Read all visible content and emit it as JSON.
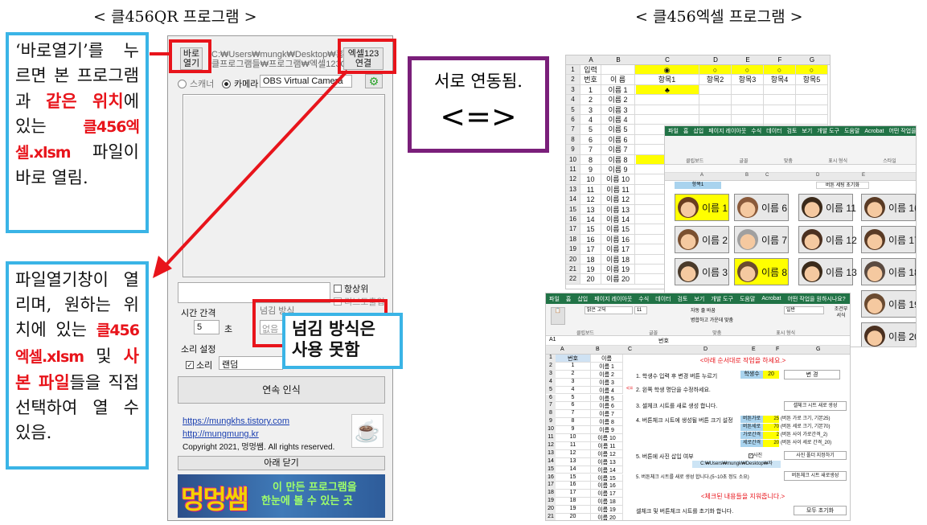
{
  "titles": {
    "left": "< 클456QR 프로그램 >",
    "right": "< 클456엑셀 프로그램 >"
  },
  "program": {
    "open_btn": "바로\n열기",
    "path_line1": "C:₩Users₩mungk₩Desktop₩홍",
    "path_line2": "클프로그램들₩프로그램₩엑셀123QR",
    "excel_btn": "엑셀123\n연결",
    "scanner": "스캐너",
    "camera": "카메라",
    "camera_select": "OBS Virtual Camera",
    "top_check": "항상위",
    "auto_check": "리브도출입",
    "interval_label": "시간 간격",
    "interval_value": "5",
    "interval_unit": "초",
    "mode_label": "넘김 방식",
    "mode_value": "없음",
    "sound_label": "소리 설정",
    "sound_check": "소리",
    "sound_value": "랜덤",
    "continuous": "연속 인식",
    "link1": "https://mungkhs.tistory.com",
    "link2": "http://mungmung.kr",
    "copyright": "Copyright 2021, 멍멍쌤. All rights reserved.",
    "close": "아래 닫기",
    "banner_logo": "멍멍쌤",
    "banner_line1": "이 만든 프로그램을",
    "banner_line2": "한눈에 볼 수 있는 곳"
  },
  "notes": {
    "open": {
      "a": "‘바로열기’를 누르면 본 프로그램과 ",
      "b": "같은 위치",
      "c": "에 있는 ",
      "d": "클456엑셀.xlsm",
      "e": " 파일이 바로 열림."
    },
    "excel": {
      "a": "파일열기창이 열리며, 원하는 위치에 있는 ",
      "b": "클456엑셀.xlsm",
      "c": " 및 ",
      "d": "사본 파일",
      "e": "들을 직접 선택하여 열 수 있음."
    },
    "mode": "넘김 방식은 사용 못함",
    "linked_line1": "서로 연동됨.",
    "linked_line2": "<=>"
  },
  "excel1": {
    "cols": [
      "A",
      "B",
      "C",
      "D",
      "E",
      "F",
      "G"
    ],
    "row1_label": "입력",
    "header": [
      "번호",
      "이 름",
      "항목1",
      "항목2",
      "항목3",
      "항목4",
      "항목5"
    ],
    "rows": [
      [
        "1",
        "이름 1"
      ],
      [
        "2",
        "이름 2"
      ],
      [
        "3",
        "이름 3"
      ],
      [
        "4",
        "이름 4"
      ],
      [
        "5",
        "이름 5"
      ],
      [
        "6",
        "이름 6"
      ],
      [
        "7",
        "이름 7"
      ],
      [
        "8",
        "이름 8"
      ],
      [
        "9",
        "이름 9"
      ],
      [
        "10",
        "이름 10"
      ],
      [
        "11",
        "이름 11"
      ],
      [
        "12",
        "이름 12"
      ],
      [
        "13",
        "이름 13"
      ],
      [
        "14",
        "이름 14"
      ],
      [
        "15",
        "이름 15"
      ],
      [
        "16",
        "이름 16"
      ],
      [
        "17",
        "이름 17"
      ],
      [
        "18",
        "이름 18"
      ],
      [
        "19",
        "이름 19"
      ],
      [
        "20",
        "이름 20"
      ]
    ],
    "mark": "♣"
  },
  "excel2": {
    "tabs": [
      "파일",
      "홈",
      "삽입",
      "페이지 레이아웃",
      "수식",
      "데이터",
      "검토",
      "보기",
      "개발 도구",
      "도움말",
      "Acrobat",
      "어떤 작업을 원하시나요?"
    ],
    "groups": [
      "클립보드",
      "글꼴",
      "맞춤",
      "표시 형식",
      "스타일"
    ],
    "top_label1": "항목1",
    "reset_label": "버튼 세팅 초기화",
    "buttons": [
      "이름 1",
      "이름 6",
      "이름 11",
      "이름 16",
      "이름 2",
      "이름 7",
      "이름 12",
      "이름 17",
      "이름 3",
      "이름 8",
      "이름 13",
      "이름 18",
      "이름 19",
      "이름 20"
    ]
  },
  "excel3": {
    "tabs": [
      "파일",
      "홈",
      "삽입",
      "페이지 레이아웃",
      "수식",
      "데이터",
      "검토",
      "보기",
      "개발 도구",
      "도움말",
      "Acrobat",
      "어떤 작업을 원하시나요?"
    ],
    "font_name": "맑은 고딕",
    "font_size": "11",
    "wrap": "자동 줄 바꿈",
    "merge": "병합하고 가운데 맞춤",
    "number_format": "일반",
    "groups": [
      "클립보드",
      "글꼴",
      "맞춤",
      "표시 형식"
    ],
    "style_btn": "조건부 서식",
    "cell_ref": "A1",
    "fx_value": "번호",
    "cols": [
      "A",
      "B",
      "C",
      "D",
      "E",
      "F",
      "G"
    ],
    "instruction_title": "<아래 순서대로 작업을 하세요.>",
    "step1": "1. 학생수 입력 후 변경 버튼 누르기",
    "students_label": "학생수",
    "students_value": "20",
    "change_btn": "변 경",
    "step2_arrow": "<=",
    "step2": "2. 왼쪽 학생 명단을 수정하세요.",
    "step3": "3. 셀체크 시트를 새로 생성 합니다.",
    "create_btn": "셀체크 시트 새로 생성",
    "step4": "4. 버튼체크 시트에 생성될 버튼 크기 설정",
    "settings": [
      {
        "label": "버튼가로",
        "value": "25",
        "note": "(버튼 가로 크기, 기본25)"
      },
      {
        "label": "버튼세로",
        "value": "70",
        "note": "(버튼 세로 크기, 기본70)"
      },
      {
        "label": "가로간격",
        "value": "2",
        "note": "(버튼 사이 가로간격_2)"
      },
      {
        "label": "세로간격",
        "value": "20",
        "note": "(버튼 사이 세로 간격_20)"
      }
    ],
    "step5": "5. 버튼에 사진 삽입 여부",
    "photo_check": "사진",
    "photo_btn": "사진 폴더 지정하기",
    "photo_path": "C:₩Users₩mungk₩Desktop₩자",
    "step6": "5. 버튼체크 시트를 새로 생성 합니다.(5~10초 정도 소요)",
    "create_btn2": "버튼체크 시트 새로생성",
    "clear_title": "<체크된 내용들을 지워줍니다.>",
    "reset_text": "셀체크 및 버튼체크 시트를 초기화 합니다.",
    "reset_btn": "모두 초기화",
    "rows": [
      [
        "번호",
        "이름"
      ],
      [
        "1",
        "이름 1"
      ],
      [
        "2",
        "이름 2"
      ],
      [
        "3",
        "이름 3"
      ],
      [
        "4",
        "이름 4"
      ],
      [
        "5",
        "이름 5"
      ],
      [
        "6",
        "이름 6"
      ],
      [
        "7",
        "이름 7"
      ],
      [
        "8",
        "이름 8"
      ],
      [
        "9",
        "이름 9"
      ],
      [
        "10",
        "이름 10"
      ],
      [
        "11",
        "이름 11"
      ],
      [
        "12",
        "이름 12"
      ],
      [
        "13",
        "이름 13"
      ],
      [
        "14",
        "이름 14"
      ],
      [
        "15",
        "이름 15"
      ],
      [
        "16",
        "이름 16"
      ],
      [
        "17",
        "이름 17"
      ],
      [
        "18",
        "이름 18"
      ],
      [
        "19",
        "이름 19"
      ],
      [
        "20",
        "이름 20"
      ]
    ]
  },
  "colors": {
    "red": "#e8141b",
    "blue": "#3ab4e6",
    "purple": "#7a1f7a",
    "excel_green": "#217346",
    "yellow": "#ffff00"
  }
}
